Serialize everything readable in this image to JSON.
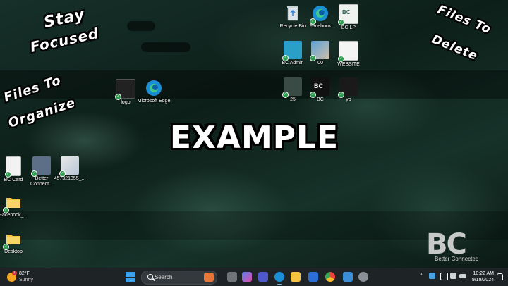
{
  "overlay": {
    "stay_focused": [
      "Stay",
      "Focused"
    ],
    "files_to_organize": [
      "Files To",
      "Organize"
    ],
    "files_to_delete": [
      "Files To",
      "Delete"
    ],
    "center_label": "EXAMPLE"
  },
  "desktop_icons": {
    "recycle_bin": "Recycle Bin",
    "facebook": "Facebook",
    "bc_lp": "BC LP",
    "bc_admin": "BC Admin",
    "double_zero": "00",
    "website": "WEBSITE",
    "twenty_five": "25",
    "bc": "BC",
    "yo": "yo",
    "logo": "logo",
    "microsoft_edge": "Microsoft Edge",
    "bc_card": "BC Card",
    "better_connect": "Better Connect...",
    "numbered_file": "457321355_...",
    "facebook_folder": "Facebook_...",
    "desktop_folder": "Desktop"
  },
  "watermark": {
    "letters": "BC",
    "subtitle": "Better Connected"
  },
  "taskbar": {
    "weather_temp": "82°F",
    "weather_cond": "Sunny",
    "weather_badge": "1",
    "search_placeholder": "Search",
    "time": "10:22 AM",
    "date": "9/19/2024"
  },
  "colors": {
    "windows_blue": "#3aa3f0",
    "taskbar_bg": "#1e2326",
    "sync_check_green": "#2e9c4e"
  }
}
